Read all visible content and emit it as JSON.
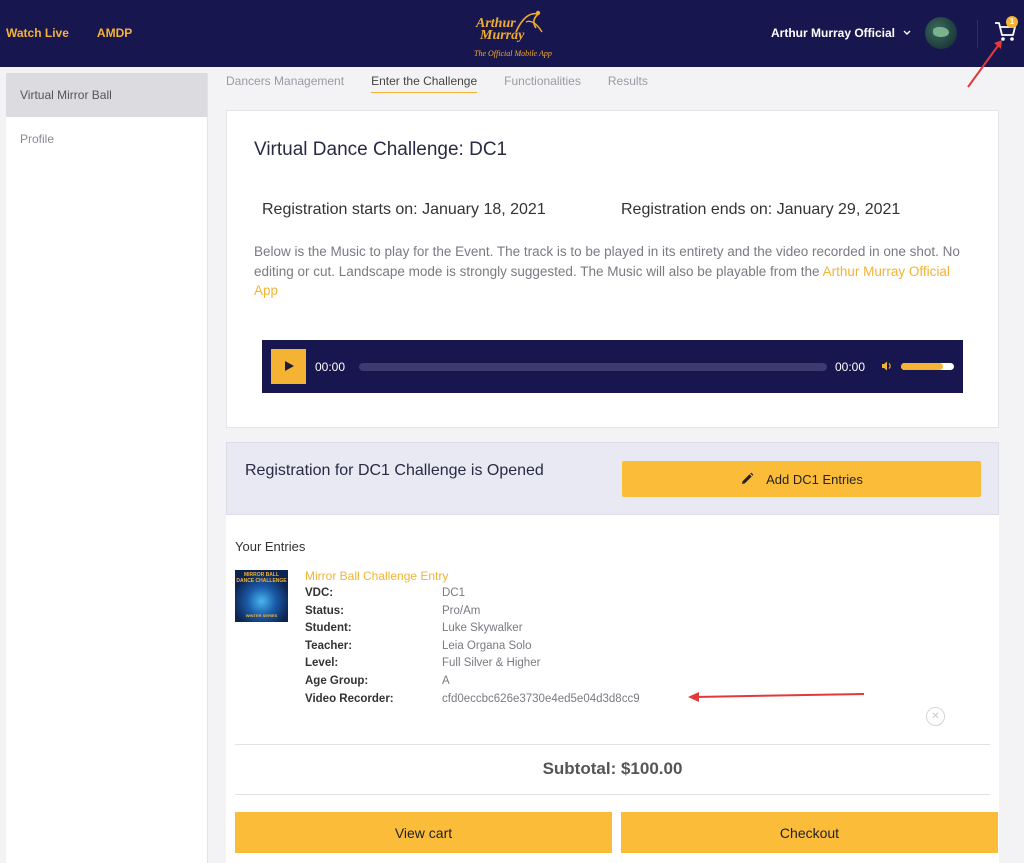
{
  "topbar": {
    "nav": [
      "Watch Live",
      "AMDP"
    ],
    "logo": {
      "line1": "Arthur",
      "line2": "Murray",
      "tagline": "The Official Mobile App"
    },
    "user_name": "Arthur Murray Official",
    "cart_count": "1",
    "accent_color": "#f4b333",
    "bg_color": "#18164f"
  },
  "sidebar": {
    "items": [
      {
        "label": "Virtual Mirror Ball",
        "active": true
      },
      {
        "label": "Profile",
        "active": false
      }
    ]
  },
  "tabs": [
    {
      "label": "Dancers Management",
      "active": false
    },
    {
      "label": "Enter the Challenge",
      "active": true
    },
    {
      "label": "Functionalities",
      "active": false
    },
    {
      "label": "Results",
      "active": false
    }
  ],
  "challenge": {
    "title": "Virtual Dance Challenge: DC1",
    "reg_start": "Registration starts on: January 18, 2021",
    "reg_end": "Registration ends on: January 29, 2021",
    "description": "Below is the Music to play for the Event. The track is to be played in its entirety and the video recorded in one shot. No editing or cut. Landscape mode is strongly suggested. The Music will also be playable from the ",
    "app_link": "Arthur Murray Official App",
    "player": {
      "current_time": "00:00",
      "duration": "00:00",
      "volume": 0.8
    }
  },
  "registration": {
    "status_text": "Registration for DC1 Challenge is Opened",
    "add_button": "Add DC1 Entries"
  },
  "entries": {
    "title": "Your Entries",
    "items": [
      {
        "thumb_title": "MIRROR BALL DANCE CHALLENGE",
        "thumb_sub": "WINTER SERIES",
        "name": "Mirror Ball Challenge Entry",
        "fields": [
          {
            "key": "VDC:",
            "value": "DC1"
          },
          {
            "key": "Status:",
            "value": "Pro/Am"
          },
          {
            "key": "Student:",
            "value": "Luke Skywalker"
          },
          {
            "key": "Teacher:",
            "value": "Leia Organa Solo"
          },
          {
            "key": "Level:",
            "value": "Full Silver & Higher"
          },
          {
            "key": "Age Group:",
            "value": "A"
          },
          {
            "key": "Video Recorder:",
            "value": "cfd0eccbc626e3730e4ed5e04d3d8cc9"
          }
        ]
      }
    ],
    "subtotal": "Subtotal: $100.00",
    "view_cart": "View cart",
    "checkout": "Checkout"
  }
}
